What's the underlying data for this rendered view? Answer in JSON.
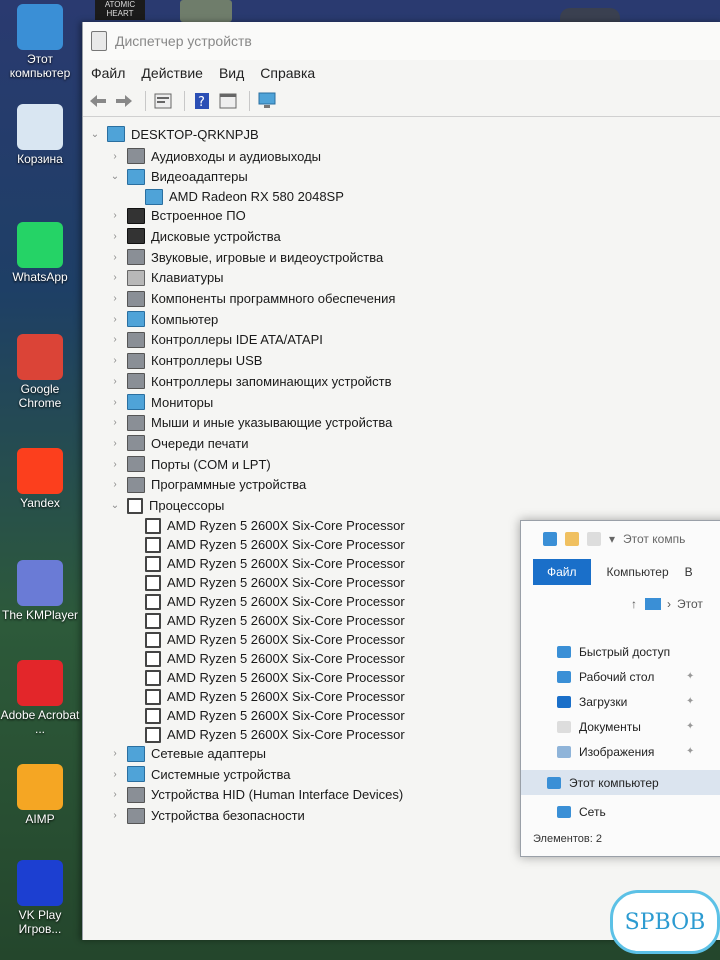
{
  "desktop": {
    "top_game_label": "ATOMIC HEART",
    "icons": [
      {
        "label": "Этот компьютер",
        "icon": "this-pc-icon",
        "color": "#3a8fd6"
      },
      {
        "label": "Корзина",
        "icon": "recycle-bin-icon",
        "color": "#d9e6f2"
      },
      {
        "label": "WhatsApp",
        "icon": "whatsapp-icon",
        "color": "#25d366"
      },
      {
        "label": "Google Chrome",
        "icon": "chrome-icon",
        "color": "#db4437"
      },
      {
        "label": "Yandex",
        "icon": "yandex-icon",
        "color": "#fc3f1d"
      },
      {
        "label": "The KMPlayer",
        "icon": "kmplayer-icon",
        "color": "#6a7bd6"
      },
      {
        "label": "Adobe Acrobat ...",
        "icon": "acrobat-icon",
        "color": "#e3262a"
      },
      {
        "label": "AIMP",
        "icon": "aimp-icon",
        "color": "#f5a623"
      },
      {
        "label": "VK Play Игров...",
        "icon": "vkplay-icon",
        "color": "#1c3fd1"
      }
    ]
  },
  "device_manager": {
    "title": "Диспетчер устройств",
    "menu": [
      "Файл",
      "Действие",
      "Вид",
      "Справка"
    ],
    "toolbar": [
      "back-icon",
      "forward-icon",
      "properties-icon",
      "help-icon",
      "update-driver-icon",
      "scan-hardware-icon"
    ],
    "root": "DESKTOP-QRKNPJB",
    "tree": [
      {
        "label": "Аудиовходы и аудиовыходы",
        "expanded": false,
        "icon": "audio-io-icon"
      },
      {
        "label": "Видеоадаптеры",
        "expanded": true,
        "icon": "display-adapter-icon",
        "children": [
          "AMD Radeon RX 580 2048SP"
        ]
      },
      {
        "label": "Встроенное ПО",
        "expanded": false,
        "icon": "firmware-icon"
      },
      {
        "label": "Дисковые устройства",
        "expanded": false,
        "icon": "disk-drive-icon"
      },
      {
        "label": "Звуковые, игровые и видеоустройства",
        "expanded": false,
        "icon": "sound-icon"
      },
      {
        "label": "Клавиатуры",
        "expanded": false,
        "icon": "keyboard-icon"
      },
      {
        "label": "Компоненты программного обеспечения",
        "expanded": false,
        "icon": "software-component-icon"
      },
      {
        "label": "Компьютер",
        "expanded": false,
        "icon": "computer-icon"
      },
      {
        "label": "Контроллеры IDE ATA/ATAPI",
        "expanded": false,
        "icon": "ide-controller-icon"
      },
      {
        "label": "Контроллеры USB",
        "expanded": false,
        "icon": "usb-controller-icon"
      },
      {
        "label": "Контроллеры запоминающих устройств",
        "expanded": false,
        "icon": "storage-controller-icon"
      },
      {
        "label": "Мониторы",
        "expanded": false,
        "icon": "monitor-icon"
      },
      {
        "label": "Мыши и иные указывающие устройства",
        "expanded": false,
        "icon": "mouse-icon"
      },
      {
        "label": "Очереди печати",
        "expanded": false,
        "icon": "print-queue-icon"
      },
      {
        "label": "Порты (COM и LPT)",
        "expanded": false,
        "icon": "ports-icon"
      },
      {
        "label": "Программные устройства",
        "expanded": false,
        "icon": "software-device-icon"
      },
      {
        "label": "Процессоры",
        "expanded": true,
        "icon": "processor-icon",
        "children": [
          "AMD Ryzen 5 2600X Six-Core Processor",
          "AMD Ryzen 5 2600X Six-Core Processor",
          "AMD Ryzen 5 2600X Six-Core Processor",
          "AMD Ryzen 5 2600X Six-Core Processor",
          "AMD Ryzen 5 2600X Six-Core Processor",
          "AMD Ryzen 5 2600X Six-Core Processor",
          "AMD Ryzen 5 2600X Six-Core Processor",
          "AMD Ryzen 5 2600X Six-Core Processor",
          "AMD Ryzen 5 2600X Six-Core Processor",
          "AMD Ryzen 5 2600X Six-Core Processor",
          "AMD Ryzen 5 2600X Six-Core Processor",
          "AMD Ryzen 5 2600X Six-Core Processor"
        ]
      },
      {
        "label": "Сетевые адаптеры",
        "expanded": false,
        "icon": "network-adapter-icon"
      },
      {
        "label": "Системные устройства",
        "expanded": false,
        "icon": "system-device-icon"
      },
      {
        "label": "Устройства HID (Human Interface Devices)",
        "expanded": false,
        "icon": "hid-icon"
      },
      {
        "label": "Устройства безопасности",
        "expanded": false,
        "icon": "security-device-icon"
      }
    ]
  },
  "explorer": {
    "title": "Этот компь",
    "ribbon_file": "Файл",
    "ribbon_tabs": [
      "Компьютер",
      "В"
    ],
    "address": "Этот",
    "nav": [
      {
        "label": "Быстрый доступ",
        "icon": "star-icon",
        "pinned": false,
        "selected": false
      },
      {
        "label": "Рабочий стол",
        "icon": "desktop-folder-icon",
        "pinned": true,
        "selected": false
      },
      {
        "label": "Загрузки",
        "icon": "downloads-icon",
        "pinned": true,
        "selected": false
      },
      {
        "label": "Документы",
        "icon": "documents-icon",
        "pinned": true,
        "selected": false
      },
      {
        "label": "Изображения",
        "icon": "pictures-icon",
        "pinned": true,
        "selected": false
      },
      {
        "label": "Этот компьютер",
        "icon": "this-pc-icon",
        "pinned": false,
        "selected": true
      },
      {
        "label": "Сеть",
        "icon": "network-icon",
        "pinned": false,
        "selected": false
      }
    ],
    "status": "Элементов: 2"
  },
  "watermark": "SPBOB"
}
